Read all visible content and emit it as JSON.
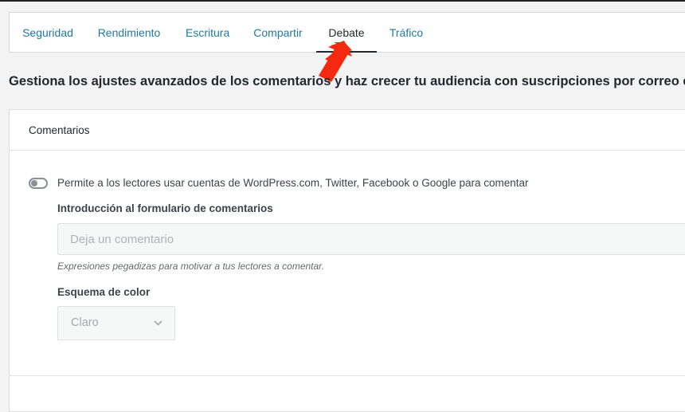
{
  "tabs": [
    {
      "label": "Seguridad"
    },
    {
      "label": "Rendimiento"
    },
    {
      "label": "Escritura"
    },
    {
      "label": "Compartir"
    },
    {
      "label": "Debate"
    },
    {
      "label": "Tráfico"
    }
  ],
  "active_tab": "Debate",
  "intro_text": "Gestiona los ajustes avanzados de los comentarios y haz crecer tu audiencia con suscripciones por correo electrónico.",
  "comments_card": {
    "title": "Comentarios",
    "toggle_label": "Permite a los lectores usar cuentas de WordPress.com, Twitter, Facebook o Google para comentar",
    "toggle_on": false,
    "intro_field_label": "Introducción al formulario de comentarios",
    "intro_field_placeholder": "Deja un comentario",
    "intro_field_help": "Expresiones pegadizas para motivar a tus lectores a comentar.",
    "color_scheme_label": "Esquema de color",
    "color_scheme_value": "Claro"
  },
  "colors": {
    "link": "#1e7aa3",
    "annotation_arrow": "#f4290f",
    "active_tab_underline": "#23282d"
  },
  "icons": {
    "annotation": "red-arrow-icon",
    "select": "chevron-down-icon"
  }
}
